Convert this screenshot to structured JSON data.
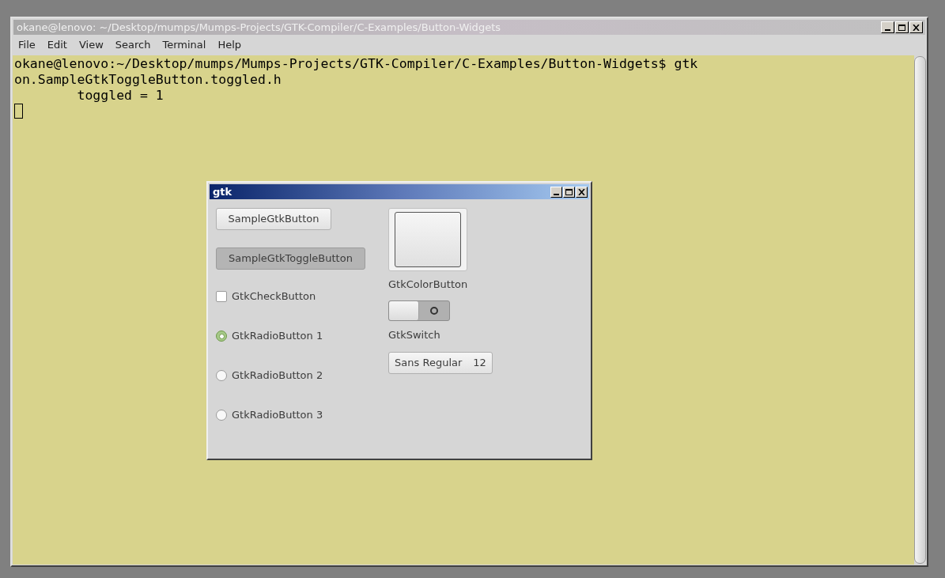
{
  "terminal_window": {
    "title": "okane@lenovo: ~/Desktop/mumps/Mumps-Projects/GTK-Compiler/C-Examples/Button-Widgets",
    "menu": [
      "File",
      "Edit",
      "View",
      "Search",
      "Terminal",
      "Help"
    ],
    "lines": [
      "okane@lenovo:~/Desktop/mumps/Mumps-Projects/GTK-Compiler/C-Examples/Button-Widgets$ gtk",
      "on.SampleGtkToggleButton.toggled.h",
      "        toggled = 1"
    ]
  },
  "gtk_window": {
    "title": "gtk",
    "button": {
      "label": "SampleGtkButton"
    },
    "toggle_button": {
      "label": "SampleGtkToggleButton",
      "selected": true
    },
    "check_button": {
      "label": "GtkCheckButton",
      "checked": false
    },
    "radio_buttons": [
      {
        "label": "GtkRadioButton 1",
        "selected": true
      },
      {
        "label": "GtkRadioButton 2",
        "selected": false
      },
      {
        "label": "GtkRadioButton 3",
        "selected": false
      }
    ],
    "color_button": {
      "label": "GtkColorButton"
    },
    "switch": {
      "label": "GtkSwitch",
      "on": false
    },
    "font_button": {
      "font": "Sans Regular",
      "size": "12"
    }
  }
}
